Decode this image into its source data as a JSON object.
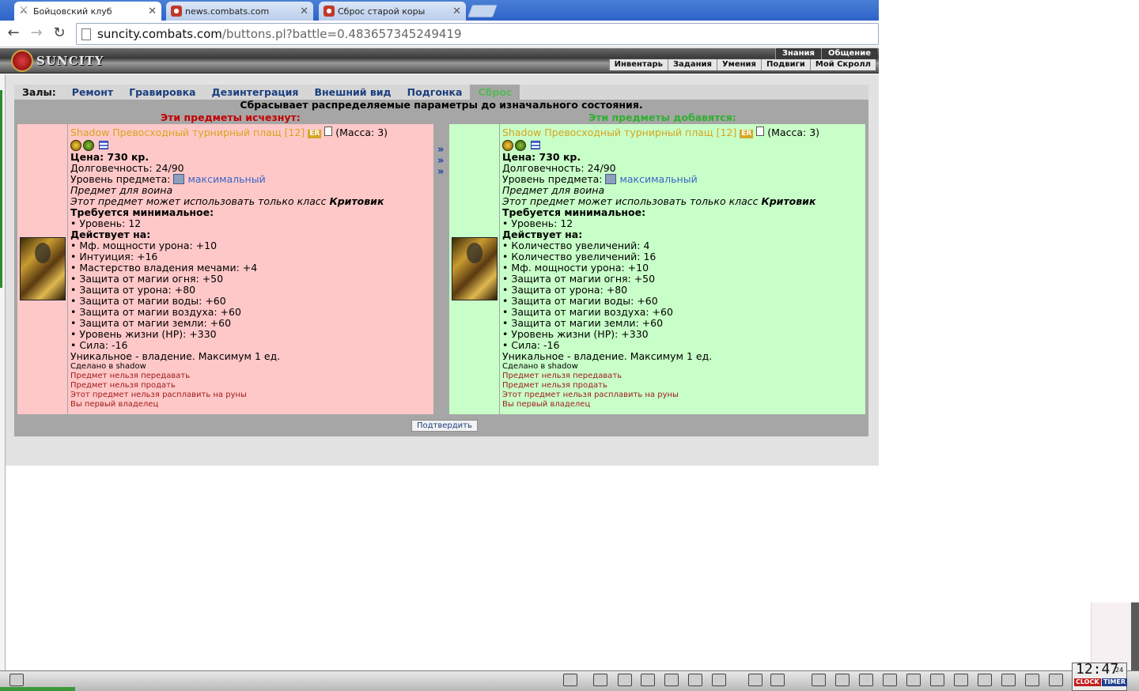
{
  "browser": {
    "tabs": [
      {
        "title": "Бойцовский клуб",
        "active": true
      },
      {
        "title": "news.combats.com",
        "active": false
      },
      {
        "title": "Сброс старой коры",
        "active": false
      }
    ],
    "url_domain": "suncity.combats.com",
    "url_path": "/buttons.pl?battle=0.483657345249419"
  },
  "game": {
    "logo_text": "SUNCITY",
    "top_menu": [
      "Знания",
      "Общение"
    ],
    "bottom_menu": [
      "Инвентарь",
      "Задания",
      "Умения",
      "Подвиги",
      "Мой Скролл"
    ],
    "halls_label": "Залы:",
    "halls": [
      "Ремонт",
      "Гравировка",
      "Дезинтеграция",
      "Внешний вид",
      "Подгонка",
      "Сброс"
    ],
    "active_hall": "Сброс",
    "description": "Сбрасывает распределяемые параметры до изначального состояния.",
    "left_title": "Эти предметы исчезнут:",
    "right_title": "Эти предметы добавятся:",
    "arrows": [
      "»",
      "»",
      "»"
    ],
    "confirm_label": "Подтвердить",
    "accent_colors": {
      "left_bg": "#ffc8c8",
      "right_bg": "#c8ffc8",
      "item_name": "#d8a41e"
    }
  },
  "item_left": {
    "name": "Shadow Превосходный турнирный плащ [12]",
    "er_badge": "ER",
    "mass": "(Масса: 3)",
    "price": "Цена: 730 кр.",
    "durability": "Долговечность: 24/90",
    "level_label": "Уровень предмета:",
    "level_value": "максимальный",
    "for_class": "Предмет для воина",
    "class_restriction_prefix": "Этот предмет может использовать только класс ",
    "class_restriction_class": "Критовик",
    "requires_title": "Требуется минимальное:",
    "requires": [
      "• Уровень: 12"
    ],
    "effects_title": "Действует на:",
    "effects": [
      "• Мф. мощности урона: +10",
      "• Интуиция: +16",
      "• Мастерство владения мечами: +4",
      "• Защита от магии огня: +50",
      "• Защита от урона: +80",
      "• Защита от магии воды: +60",
      "• Защита от магии воздуха: +60",
      "• Защита от магии земли: +60",
      "• Уровень жизни (HP): +330",
      "• Сила: -16"
    ],
    "unique": "Уникальное - владение. Максимум 1 ед.",
    "made_in": "Сделано в shadow",
    "notes": [
      "Предмет нельзя передавать",
      "Предмет нельзя продать",
      "Этот предмет нельзя расплавить на руны",
      "Вы первый владелец"
    ]
  },
  "item_right": {
    "name": "Shadow Превосходный турнирный плащ [12]",
    "er_badge": "ER",
    "mass": "(Масса: 3)",
    "price": "Цена: 730 кр.",
    "durability": "Долговечность: 24/90",
    "level_label": "Уровень предмета:",
    "level_value": "максимальный",
    "for_class": "Предмет для воина",
    "class_restriction_prefix": "Этот предмет может использовать только класс ",
    "class_restriction_class": "Критовик",
    "requires_title": "Требуется минимальное:",
    "requires": [
      "• Уровень: 12"
    ],
    "effects_title": "Действует на:",
    "effects": [
      "• Количество увеличений: 4",
      "• Количество увеличений: 16",
      "• Мф. мощности урона: +10",
      "• Защита от магии огня: +50",
      "• Защита от урона: +80",
      "• Защита от магии воды: +60",
      "• Защита от магии воздуха: +60",
      "• Защита от магии земли: +60",
      "• Уровень жизни (HP): +330",
      "• Сила: -16"
    ],
    "unique": "Уникальное - владение. Максимум 1 ед.",
    "made_in": "Сделано в shadow",
    "notes": [
      "Предмет нельзя передавать",
      "Предмет нельзя продать",
      "Этот предмет нельзя расплавить на руны",
      "Вы первый владелец"
    ]
  },
  "clock": {
    "time": "12:47",
    "seconds": "24",
    "clock_label": "CLOCK",
    "timer_label": "TIMER"
  }
}
